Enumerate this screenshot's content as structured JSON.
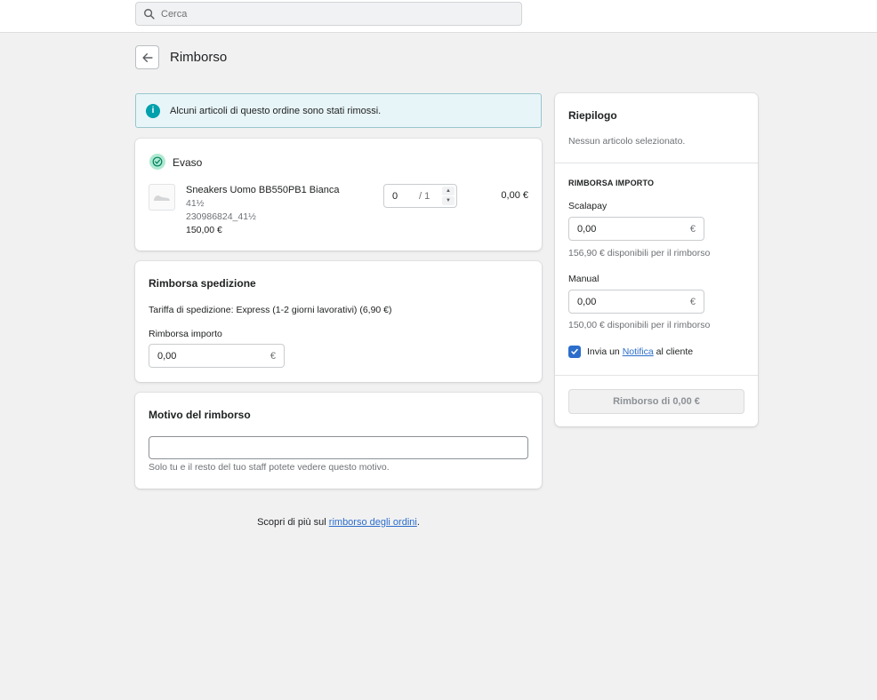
{
  "search": {
    "placeholder": "Cerca"
  },
  "page": {
    "title": "Rimborso"
  },
  "banner": {
    "text": "Alcuni articoli di questo ordine sono stati rimossi."
  },
  "fulfilled": {
    "status": "Evaso",
    "item": {
      "name": "Sneakers Uomo BB550PB1 Bianca",
      "variant": "41½",
      "sku": "230986824_41½",
      "price": "150,00 €",
      "quantity": "0",
      "quantity_max": "/ 1",
      "total": "0,00 €"
    }
  },
  "shipping": {
    "title": "Rimborsa spedizione",
    "rate": "Tariffa di spedizione: Express (1-2 giorni lavorativi) (6,90 €)",
    "amount_label": "Rimborsa importo",
    "amount_value": "0,00",
    "currency": "€"
  },
  "reason": {
    "title": "Motivo del rimborso",
    "value": "",
    "help": "Solo tu e il resto del tuo staff potete vedere questo motivo."
  },
  "summary": {
    "title": "Riepilogo",
    "empty_text": "Nessun articolo selezionato.",
    "section_title": "RIMBORSA IMPORTO",
    "methods": [
      {
        "name": "Scalapay",
        "value": "0,00",
        "currency": "€",
        "available": "156,90 € disponibili per il rimborso"
      },
      {
        "name": "Manual",
        "value": "0,00",
        "currency": "€",
        "available": "150,00 € disponibili per il rimborso"
      }
    ],
    "notify_prefix": "Invia un ",
    "notify_link": "Notifica",
    "notify_suffix": " al cliente",
    "notify_checked": true,
    "refund_button": "Rimborso di 0,00 €"
  },
  "footer": {
    "prefix": "Scopri di più sul ",
    "link": "rimborso degli ordini",
    "suffix": "."
  },
  "colors": {
    "accent": "#2c6ecb",
    "info": "#00a0ac",
    "success": "#aee9d1"
  }
}
